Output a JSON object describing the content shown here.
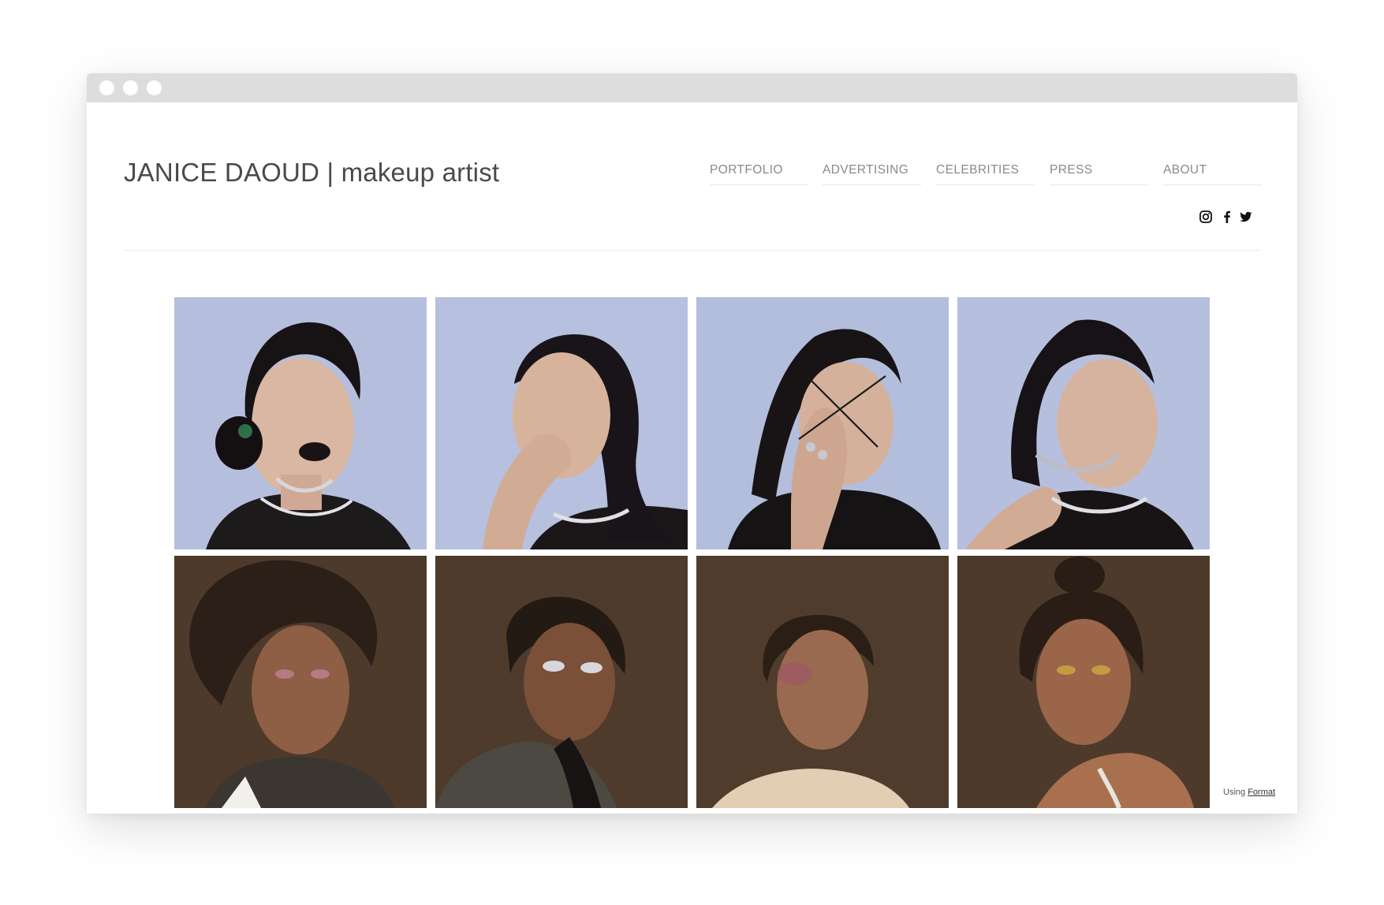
{
  "site": {
    "title": "JANICE DAOUD | makeup artist"
  },
  "nav": {
    "items": [
      {
        "label": "PORTFOLIO"
      },
      {
        "label": "ADVERTISING"
      },
      {
        "label": "CELEBRITIES"
      },
      {
        "label": "PRESS"
      },
      {
        "label": "ABOUT"
      }
    ]
  },
  "social": {
    "icons": [
      "instagram-icon",
      "facebook-icon",
      "twitter-icon"
    ]
  },
  "gallery": {
    "tiles": [
      {
        "subject": "portrait-blue-1"
      },
      {
        "subject": "portrait-blue-2"
      },
      {
        "subject": "portrait-blue-3"
      },
      {
        "subject": "portrait-blue-4"
      },
      {
        "subject": "portrait-brown-1"
      },
      {
        "subject": "portrait-brown-2"
      },
      {
        "subject": "portrait-brown-3"
      },
      {
        "subject": "portrait-brown-4"
      }
    ]
  },
  "footer": {
    "using": "Using",
    "format_link": "Format"
  },
  "colors": {
    "blue_backdrop": "#b5bfdd",
    "brown_backdrop": "#4f3c2c",
    "chrome": "#dddddd",
    "title_text": "#4a4a4a",
    "nav_text": "#8a8a8a"
  }
}
